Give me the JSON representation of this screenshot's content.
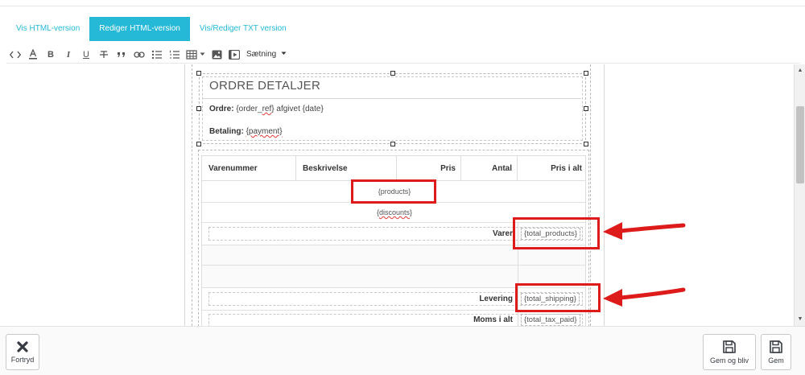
{
  "tabs": [
    {
      "label": "Vis HTML-version",
      "active": false
    },
    {
      "label": "Rediger HTML-version",
      "active": true
    },
    {
      "label": "Vis/Rediger TXT version",
      "active": false
    }
  ],
  "toolbar": {
    "items": [
      "source-code-icon",
      "text-color-icon",
      "bold-icon",
      "italic-icon",
      "underline-icon",
      "strikethrough-icon",
      "blockquote-icon",
      "link-icon",
      "bullet-list-icon",
      "numbered-list-icon",
      "table-icon",
      "image-icon",
      "media-icon"
    ],
    "bold_glyph": "B",
    "italic_glyph": "I",
    "underline_glyph": "U",
    "format_label": "Sætning"
  },
  "document": {
    "title": "ORDRE DETALJER",
    "order_label": "Ordre:",
    "order_ref": "{order_ref}",
    "order_mid": "afgivet",
    "order_date": "{date}",
    "payment_label": "Betaling:",
    "payment_value": "{payment}"
  },
  "table": {
    "headers": [
      "Varenummer",
      "Beskrivelse",
      "Pris",
      "Antal",
      "Pris i alt"
    ],
    "products_token": "{products}",
    "discounts_token": "{discounts}",
    "totals": [
      {
        "label": "Varer",
        "value": "{total_products}",
        "highlighted": true
      },
      {
        "label": "Levering",
        "value": "{total_shipping}",
        "highlighted": true
      },
      {
        "label": "Moms i alt",
        "value": "{total_tax_paid}",
        "highlighted": false
      }
    ]
  },
  "annotation_color": "#dd1b1b",
  "accent_color": "#25b9d7",
  "footer": {
    "cancel_label": "Fortryd",
    "save_stay_label": "Gem og bliv",
    "save_label": "Gem"
  }
}
